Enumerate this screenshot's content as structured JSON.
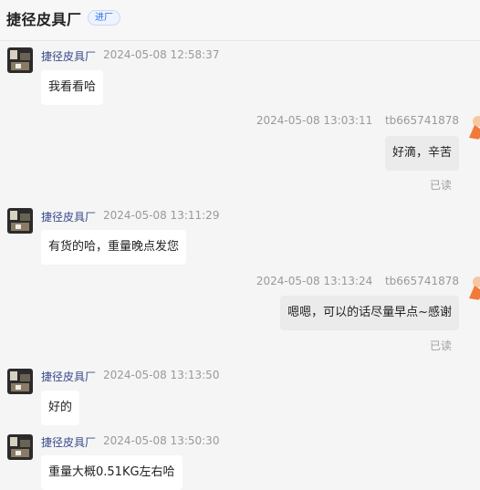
{
  "header": {
    "title": "捷径皮具厂",
    "badge": "进厂"
  },
  "messages": [
    {
      "sender": "捷径皮具厂",
      "time": "2024-05-08 12:58:37",
      "text": "我看看哈"
    },
    {
      "time": "2024-05-08 13:03:11",
      "user": "tb665741878",
      "text": "好滴，辛苦",
      "status": "已读"
    },
    {
      "sender": "捷径皮具厂",
      "time": "2024-05-08 13:11:29",
      "text": "有货的哈，重量晚点发您"
    },
    {
      "time": "2024-05-08 13:13:24",
      "user": "tb665741878",
      "text": "嗯嗯，可以的话尽量早点~感谢",
      "status": "已读"
    },
    {
      "sender": "捷径皮具厂",
      "time": "2024-05-08 13:13:50",
      "text": "好的"
    },
    {
      "sender": "捷径皮具厂",
      "time": "2024-05-08 13:50:30",
      "text": "重量大概0.51KG左右哈"
    }
  ],
  "colors": {
    "background": "#f5f5f5",
    "incoming_bubble": "#ffffff",
    "outgoing_bubble": "#ebebeb",
    "sender_name": "#3a4a8c",
    "badge": "#2f6fe0"
  },
  "icons": {
    "seller_avatar": "seller-avatar-photo",
    "buyer_avatar": "buyer-avatar-orange"
  }
}
